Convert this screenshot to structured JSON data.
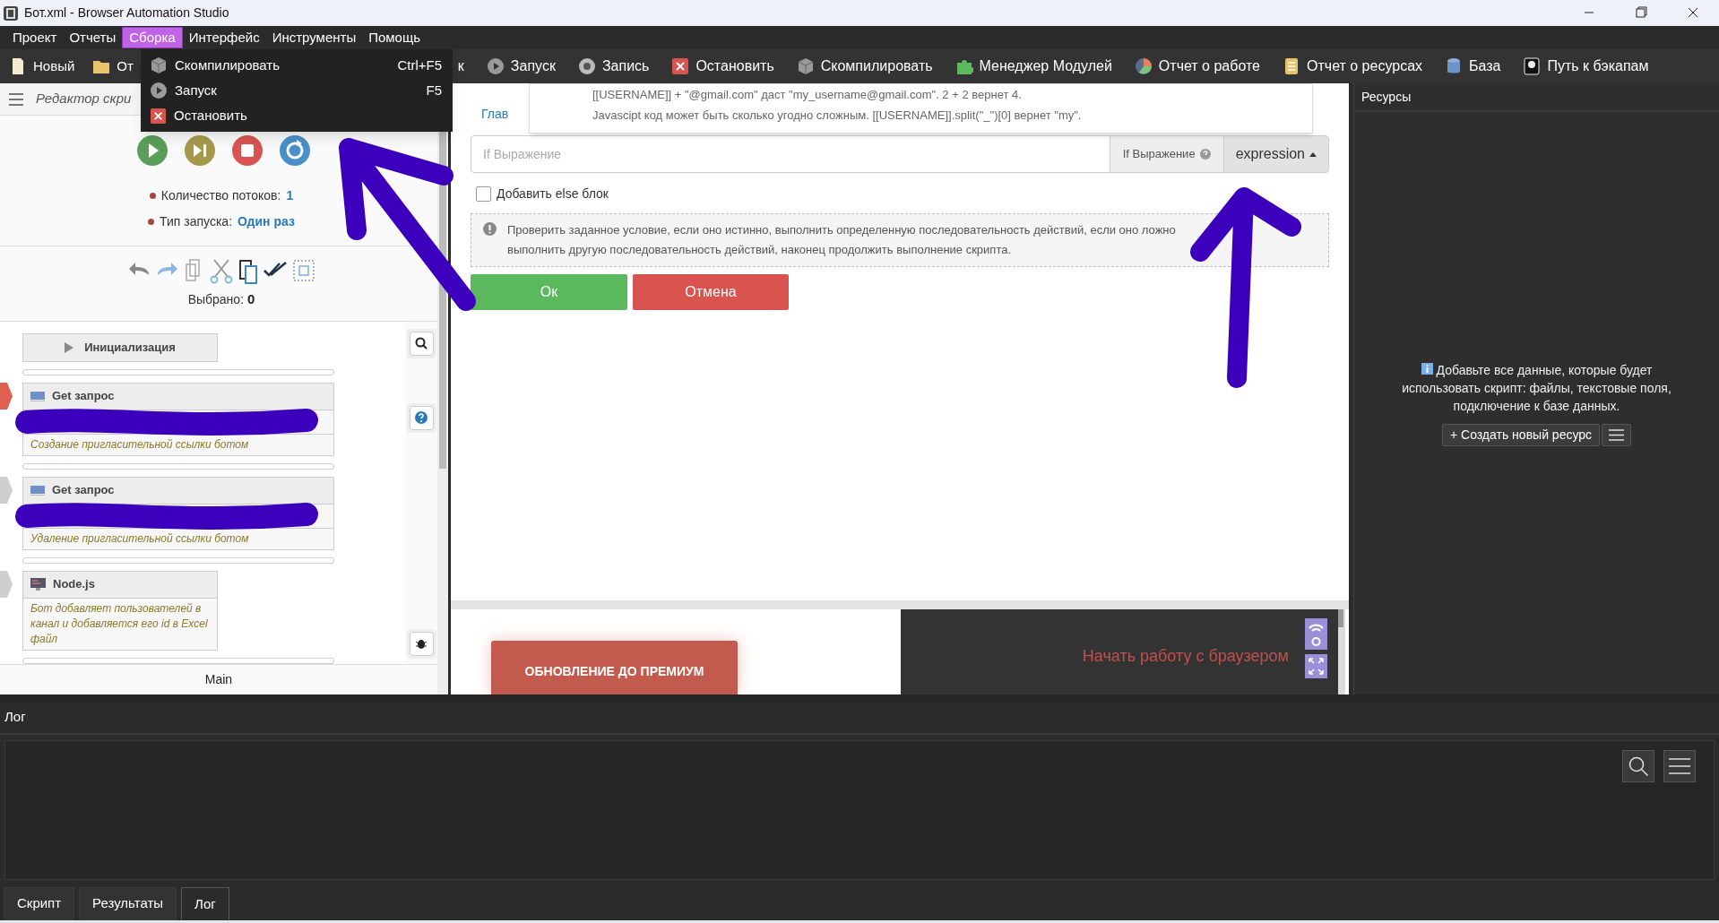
{
  "window": {
    "title": "Бот.xml - Browser Automation Studio"
  },
  "menu": [
    {
      "label": "Проект",
      "selected": false
    },
    {
      "label": "Отчеты",
      "selected": false
    },
    {
      "label": "Сборка",
      "selected": true
    },
    {
      "label": "Интерфейс",
      "selected": false
    },
    {
      "label": "Инструменты",
      "selected": false
    },
    {
      "label": "Помощь",
      "selected": false
    }
  ],
  "toolbar": {
    "left": [
      "Новый",
      "От"
    ],
    "right": [
      "к",
      "Запуск",
      "Запись",
      "Остановить",
      "Скомпилировать",
      "Менеджер Модулей",
      "Отчет о работе",
      "Отчет о ресурсах",
      "База",
      "Путь к бэкапам"
    ]
  },
  "dropdown": [
    {
      "label": "Скомпилировать",
      "shortcut": "Ctrl+F5"
    },
    {
      "label": "Запуск",
      "shortcut": "F5"
    },
    {
      "label": "Остановить"
    }
  ],
  "editor": {
    "title": "Редактор скри",
    "threads_label": "Количество потоков:",
    "threads": "1",
    "launch_label": "Тип запуска:",
    "launch": "Один раз",
    "selected_label": "Выбрано:",
    "selected_count": "0",
    "blocks": [
      {
        "kind": "section",
        "title": "Инициализация"
      },
      {
        "kind": "action",
        "title": "Get запрос",
        "comment": "Создание пригласительной ссылки ботом",
        "current": true,
        "redacted": true
      },
      {
        "kind": "action",
        "title": "Get запрос",
        "comment": "Удаление пригласительной ссылки ботом",
        "current": false,
        "redacted": true
      },
      {
        "kind": "code",
        "title": "Node.js",
        "comment": "Бот добавляет пользователей в канал и добавляется его id в Excel файл",
        "current": false,
        "redacted": false
      }
    ],
    "tab": "Main"
  },
  "dialog": {
    "breadcrumb": "Глав",
    "hint_lines": [
      "[[USERNAME]] + \"@gmail.com\" даст \"my_username@gmail.com\". 2 + 2 вернет 4.",
      "Javascipt код может быть сколько угодно сложным. [[USERNAME]].split(\"_\")[0] вернет \"my\"."
    ],
    "placeholder": "If Выражение",
    "field_label": "If Выражение",
    "mode": "expression",
    "else_label": "Добавить else блок",
    "else_checked": false,
    "info": "Проверить заданное условие, если оно истинно, выполнить определенную последовательность действий, если оно ложно выполнить другую последовательность действий, наконец продолжить выполнение скрипта.",
    "ok": "Ок",
    "cancel": "Отмена"
  },
  "promo": {
    "button": "ОБНОВЛЕНИЕ ДО ПРЕМИУМ",
    "browser_text": "Начать работу с браузером"
  },
  "resources": {
    "title": "Ресурсы",
    "message": "Добавьте все данные, которые будет использовать скрипт: файлы, текстовые поля, подключение к базе данных.",
    "create": "+ Создать новый ресурс"
  },
  "log": {
    "title": "Лог"
  },
  "bottom_tabs": [
    {
      "label": "Скрипт",
      "selected": false
    },
    {
      "label": "Результаты",
      "selected": false
    },
    {
      "label": "Лог",
      "selected": true
    }
  ]
}
